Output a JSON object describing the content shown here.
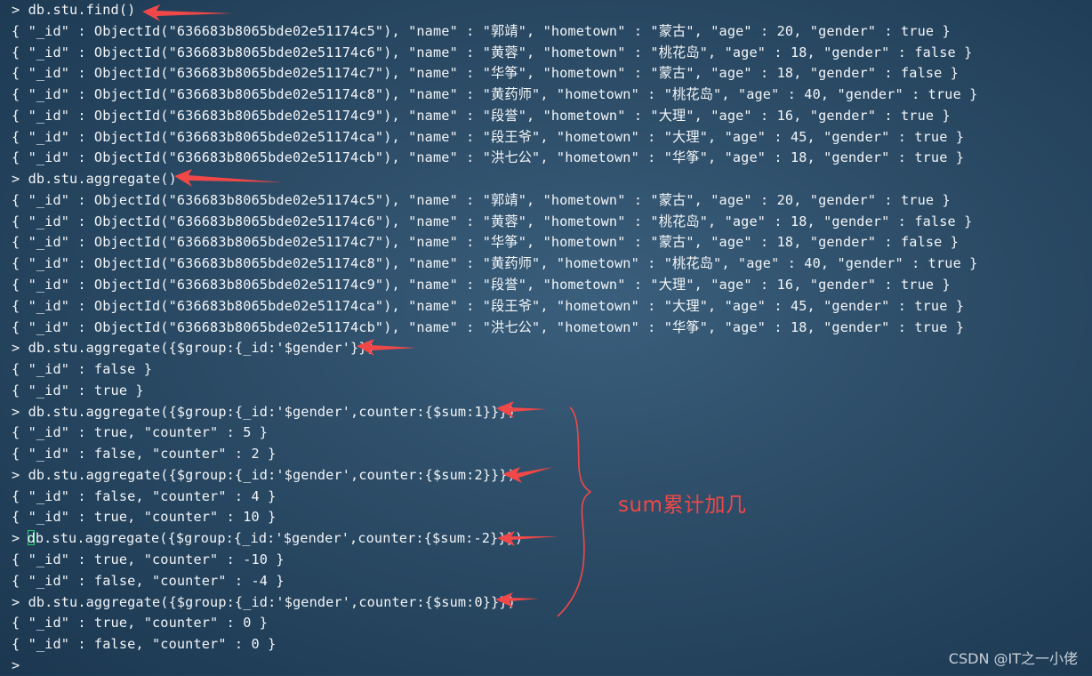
{
  "terminal": {
    "lines": [
      "> db.stu.find()",
      "{ \"_id\" : ObjectId(\"636683b8065bde02e51174c5\"), \"name\" : \"郭靖\", \"hometown\" : \"蒙古\", \"age\" : 20, \"gender\" : true }",
      "{ \"_id\" : ObjectId(\"636683b8065bde02e51174c6\"), \"name\" : \"黄蓉\", \"hometown\" : \"桃花岛\", \"age\" : 18, \"gender\" : false }",
      "{ \"_id\" : ObjectId(\"636683b8065bde02e51174c7\"), \"name\" : \"华筝\", \"hometown\" : \"蒙古\", \"age\" : 18, \"gender\" : false }",
      "{ \"_id\" : ObjectId(\"636683b8065bde02e51174c8\"), \"name\" : \"黄药师\", \"hometown\" : \"桃花岛\", \"age\" : 40, \"gender\" : true }",
      "{ \"_id\" : ObjectId(\"636683b8065bde02e51174c9\"), \"name\" : \"段誉\", \"hometown\" : \"大理\", \"age\" : 16, \"gender\" : true }",
      "{ \"_id\" : ObjectId(\"636683b8065bde02e51174ca\"), \"name\" : \"段王爷\", \"hometown\" : \"大理\", \"age\" : 45, \"gender\" : true }",
      "{ \"_id\" : ObjectId(\"636683b8065bde02e51174cb\"), \"name\" : \"洪七公\", \"hometown\" : \"华筝\", \"age\" : 18, \"gender\" : true }",
      "> db.stu.aggregate()",
      "{ \"_id\" : ObjectId(\"636683b8065bde02e51174c5\"), \"name\" : \"郭靖\", \"hometown\" : \"蒙古\", \"age\" : 20, \"gender\" : true }",
      "{ \"_id\" : ObjectId(\"636683b8065bde02e51174c6\"), \"name\" : \"黄蓉\", \"hometown\" : \"桃花岛\", \"age\" : 18, \"gender\" : false }",
      "{ \"_id\" : ObjectId(\"636683b8065bde02e51174c7\"), \"name\" : \"华筝\", \"hometown\" : \"蒙古\", \"age\" : 18, \"gender\" : false }",
      "{ \"_id\" : ObjectId(\"636683b8065bde02e51174c8\"), \"name\" : \"黄药师\", \"hometown\" : \"桃花岛\", \"age\" : 40, \"gender\" : true }",
      "{ \"_id\" : ObjectId(\"636683b8065bde02e51174c9\"), \"name\" : \"段誉\", \"hometown\" : \"大理\", \"age\" : 16, \"gender\" : true }",
      "{ \"_id\" : ObjectId(\"636683b8065bde02e51174ca\"), \"name\" : \"段王爷\", \"hometown\" : \"大理\", \"age\" : 45, \"gender\" : true }",
      "{ \"_id\" : ObjectId(\"636683b8065bde02e51174cb\"), \"name\" : \"洪七公\", \"hometown\" : \"华筝\", \"age\" : 18, \"gender\" : true }",
      "> db.stu.aggregate({$group:{_id:'$gender'}})",
      "{ \"_id\" : false }",
      "{ \"_id\" : true }",
      "> db.stu.aggregate({$group:{_id:'$gender',counter:{$sum:1}}})",
      "{ \"_id\" : true, \"counter\" : 5 }",
      "{ \"_id\" : false, \"counter\" : 2 }",
      "> db.stu.aggregate({$group:{_id:'$gender',counter:{$sum:2}}})",
      "{ \"_id\" : false, \"counter\" : 4 }",
      "{ \"_id\" : true, \"counter\" : 10 }",
      "> db.stu.aggregate({$group:{_id:'$gender',counter:{$sum:-2}}})",
      "{ \"_id\" : true, \"counter\" : -10 }",
      "{ \"_id\" : false, \"counter\" : -4 }",
      "> db.stu.aggregate({$group:{_id:'$gender',counter:{$sum:0}}})",
      "{ \"_id\" : true, \"counter\" : 0 }",
      "{ \"_id\" : false, \"counter\" : 0 }",
      ">"
    ]
  },
  "annotation": {
    "text": "sum累计加几",
    "color": "#f04848"
  },
  "watermark": "CSDN @IT之一小佬",
  "colors": {
    "text": "#f2f5f8",
    "cursor": "#2fd07a",
    "annotation": "#f04848"
  }
}
